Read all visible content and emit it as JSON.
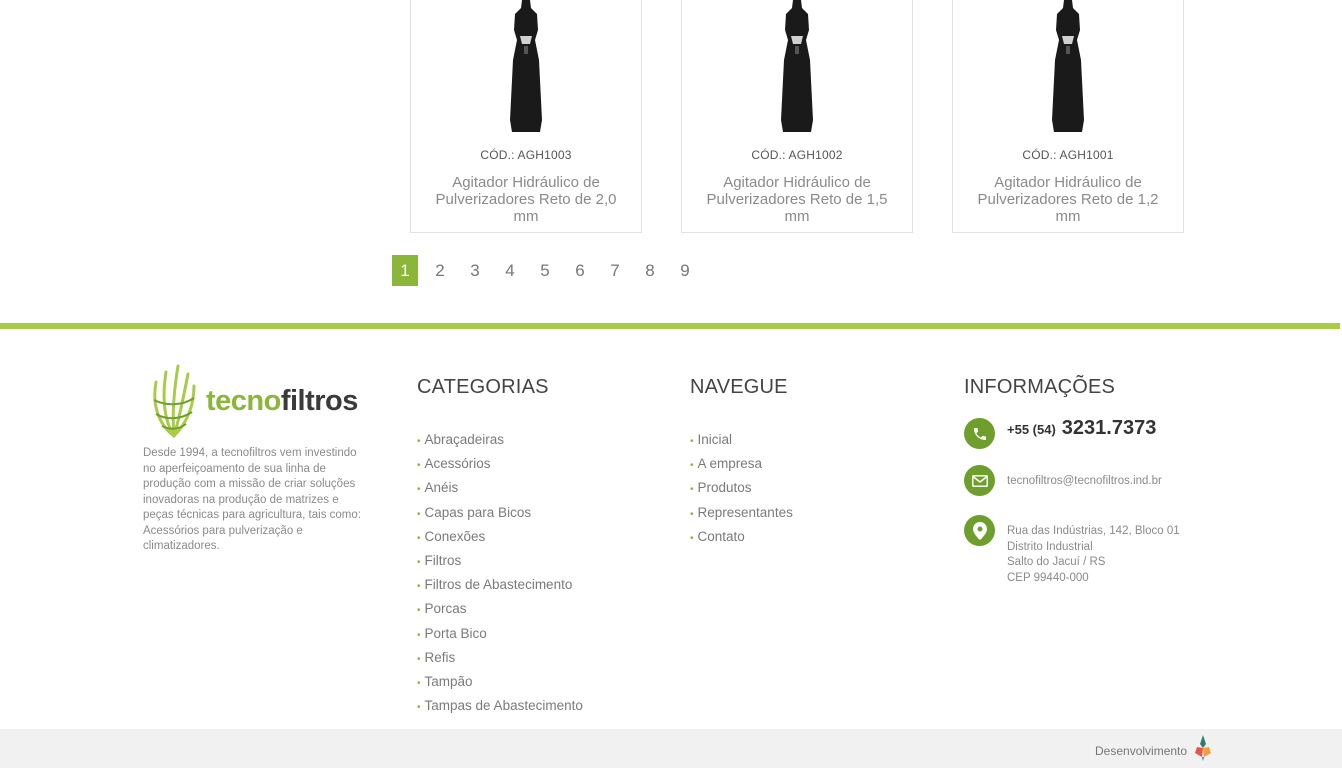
{
  "products": [
    {
      "code": "CÓD.: AGH1003",
      "title": "Agitador Hidráulico de Pulverizadores Reto de 2,0 mm"
    },
    {
      "code": "CÓD.: AGH1002",
      "title": "Agitador Hidráulico de Pulverizadores Reto de 1,5 mm"
    },
    {
      "code": "CÓD.: AGH1001",
      "title": "Agitador Hidráulico de Pulverizadores Reto de 1,2 mm"
    }
  ],
  "pagination": {
    "pages": [
      "1",
      "2",
      "3",
      "4",
      "5",
      "6",
      "7",
      "8",
      "9"
    ],
    "current": "1"
  },
  "footer": {
    "logo": {
      "part1": "tecno",
      "part2": "filtros"
    },
    "about": "Desde 1994, a tecnofiltros vem investindo no aperfeiçoamento de sua linha de produção com a missão de criar soluções inovadoras na produção de matrizes e peças técnicas para agricultura, tais como: Acessórios para pulverização e climatizadores.",
    "categories": {
      "title": "CATEGORIAS",
      "items": [
        "Abraçadeiras",
        "Acessórios",
        "Anéis",
        "Capas para Bicos",
        "Conexões",
        "Filtros",
        "Filtros de Abastecimento",
        "Porcas",
        "Porta Bico",
        "Refis",
        "Tampão",
        "Tampas de Abastecimento"
      ]
    },
    "navigate": {
      "title": "NAVEGUE",
      "items": [
        "Inicial",
        "A empresa",
        "Produtos",
        "Representantes",
        "Contato"
      ]
    },
    "info": {
      "title": "INFORMAÇÕES",
      "phone_prefix": "+55 (54)",
      "phone_number": "3231.7373",
      "email": "tecnofiltros@tecnofiltros.ind.br",
      "address_lines": [
        "Rua das Indústrias, 142, Bloco 01",
        "Distrito Industrial",
        "Salto do Jacuí / RS",
        "CEP 99440-000"
      ]
    },
    "developer_label": "Desenvolvimento"
  },
  "colors": {
    "accent": "#8bb63a",
    "bar": "#a8cc45",
    "icon": "#6e9f2c"
  }
}
